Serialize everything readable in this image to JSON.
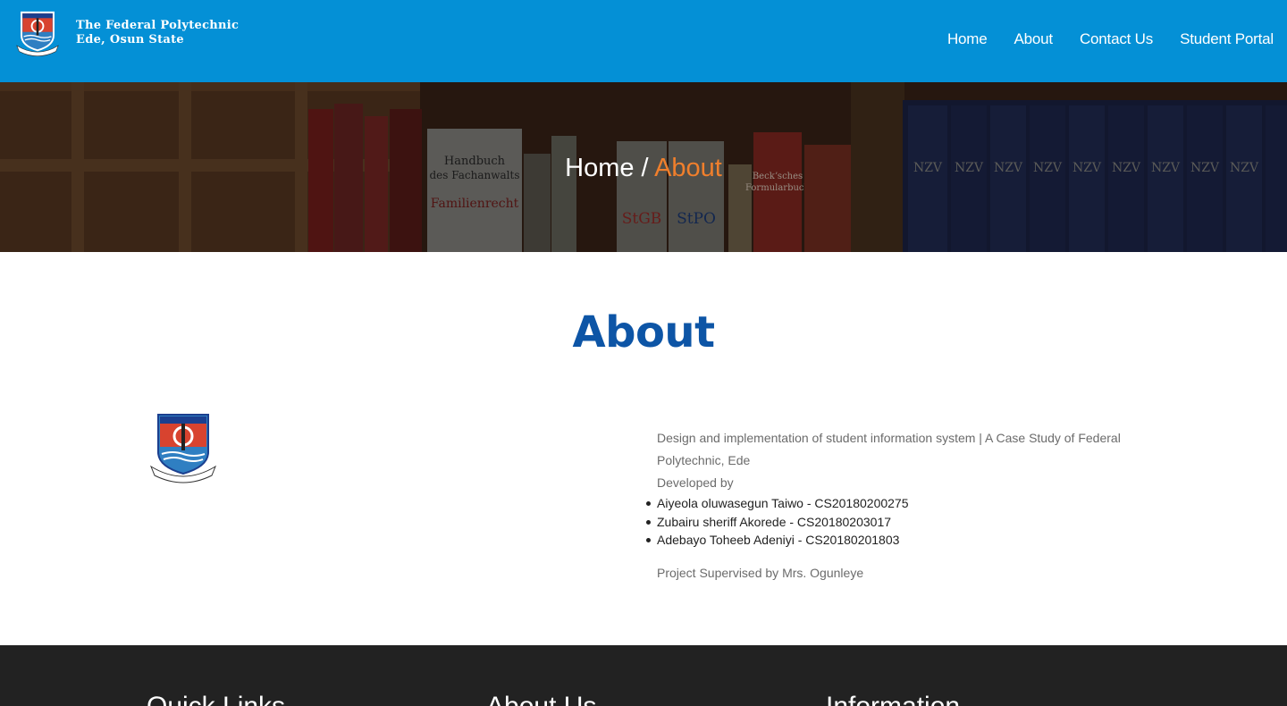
{
  "header": {
    "logo_icon": "polytechnic-crest-icon",
    "brand_line1": "The Federal Polytechnic",
    "brand_line2": "Ede, Osun State",
    "nav": {
      "home": "Home",
      "about": "About",
      "contact": "Contact Us",
      "portal": "Student Portal"
    }
  },
  "banner": {
    "breadcrumb_home": "Home",
    "separator": "/",
    "breadcrumb_current": "About",
    "background": "bookshelf-image",
    "book_titles": [
      "Handbuch",
      "des Fachanwalts",
      "Familienrecht",
      "StGB",
      "StPO",
      "Beckʼsches",
      "Formularbuch",
      "NZV"
    ]
  },
  "main": {
    "title": "About",
    "description": "Design and implementation of student information system | A Case Study of Federal Polytechnic, Ede",
    "developed_by": "Developed by",
    "developers": [
      "Aiyeola oluwasegun Taiwo - CS20180200275",
      "Zubairu sheriff Akorede - CS20180203017",
      "Adebayo Toheeb Adeniyi - CS20180201803"
    ],
    "supervised": "Project Supervised by Mrs. Ogunleye"
  },
  "footer": {
    "col1": "Quick Links",
    "col2": "About Us",
    "col3": "Information"
  },
  "colors": {
    "header_bg": "#0490d6",
    "accent_orange": "#f07f2c",
    "title_blue": "#0d55a6",
    "footer_bg": "#222222"
  }
}
